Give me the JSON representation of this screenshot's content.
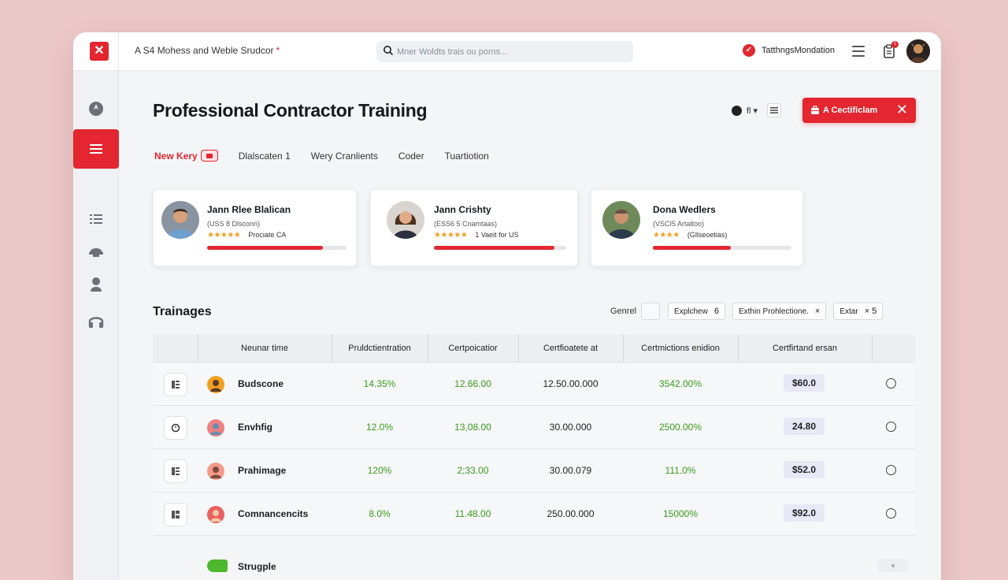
{
  "topbar": {
    "app_title": "A S4 Mohess and Weble Srudcor",
    "title_mark": "*",
    "search_placeholder": "Mner Woldts trais ou porns...",
    "status_label": "TatthngsMondation",
    "notification_count": "1"
  },
  "sidebar": {
    "items": [
      {
        "name": "compass",
        "active": false
      },
      {
        "name": "menu",
        "active": true
      },
      {
        "name": "list",
        "active": false
      },
      {
        "name": "helmet",
        "active": false
      },
      {
        "name": "person",
        "active": false
      },
      {
        "name": "headset",
        "active": false
      }
    ]
  },
  "page": {
    "title": "Professional Contractor Training",
    "lang_label": "fl",
    "cert_button_label": "A Cectificlam"
  },
  "tabs": [
    {
      "label": "New Kery",
      "active": true
    },
    {
      "label": "Dlalscaten 1",
      "active": false
    },
    {
      "label": "Wery Cranlients",
      "active": false
    },
    {
      "label": "Coder",
      "active": false
    },
    {
      "label": "Tuartiotion",
      "active": false
    }
  ],
  "cards": [
    {
      "name": "Jann Rlee Blalican",
      "role": "(USS 8 Dlsconn)",
      "stars": "★★★★★",
      "meta": "Prociate CA",
      "progress": 0.83
    },
    {
      "name": "Jann Crishty",
      "role": "(ESS6 5 Cnamtaas)",
      "stars": "★★★★★",
      "meta": "1 Vaeit for US",
      "progress": 0.91
    },
    {
      "name": "Dona Wedlers",
      "role": "(VSCI5 Artaltoo)",
      "stars": "★★★★",
      "meta": "(Gllseoetias)",
      "progress": 0.56
    }
  ],
  "trainages": {
    "title": "Trainages",
    "general_label": "Genrel",
    "chips": [
      {
        "label": "Explchew",
        "suffix": "6"
      },
      {
        "label": "Exthin Prohlectione.",
        "suffix": "×"
      },
      {
        "label": "Extar",
        "suffix": "×  5"
      }
    ],
    "columns": [
      "Neunar time",
      "Pruldctientration",
      "Certpoicatior",
      "Certfioatete at",
      "Certmictions enidion",
      "Certfirtand ersan"
    ],
    "rows": [
      {
        "name": "Budscone",
        "c1": "14.35%",
        "c2": "12.66.00",
        "c3": "12.50.00.000",
        "c4": "3542.00%",
        "amount": "$60.0",
        "dot": "#f0a020"
      },
      {
        "name": "Envhfig",
        "c1": "12.0%",
        "c2": "13,08.00",
        "c3": "30.00.000",
        "c4": "2500.00%",
        "amount": "24.80",
        "dot": "#f08080"
      },
      {
        "name": "Prahimage",
        "c1": "120%",
        "c2": "2;33.00",
        "c3": "30.00.079",
        "c4": "111.0%",
        "amount": "$52.0",
        "dot": "#f49a8a"
      },
      {
        "name": "Comnancencits",
        "c1": "8.0%",
        "c2": "11.48.00",
        "c3": "250.00.000",
        "c4": "15000%",
        "amount": "$92.0",
        "dot": "#e86060"
      }
    ],
    "extra_row": {
      "name": "Strugple"
    }
  },
  "colors": {
    "accent": "#e3262f",
    "positive": "#3a9b1a",
    "background": "#ecc9c9"
  }
}
